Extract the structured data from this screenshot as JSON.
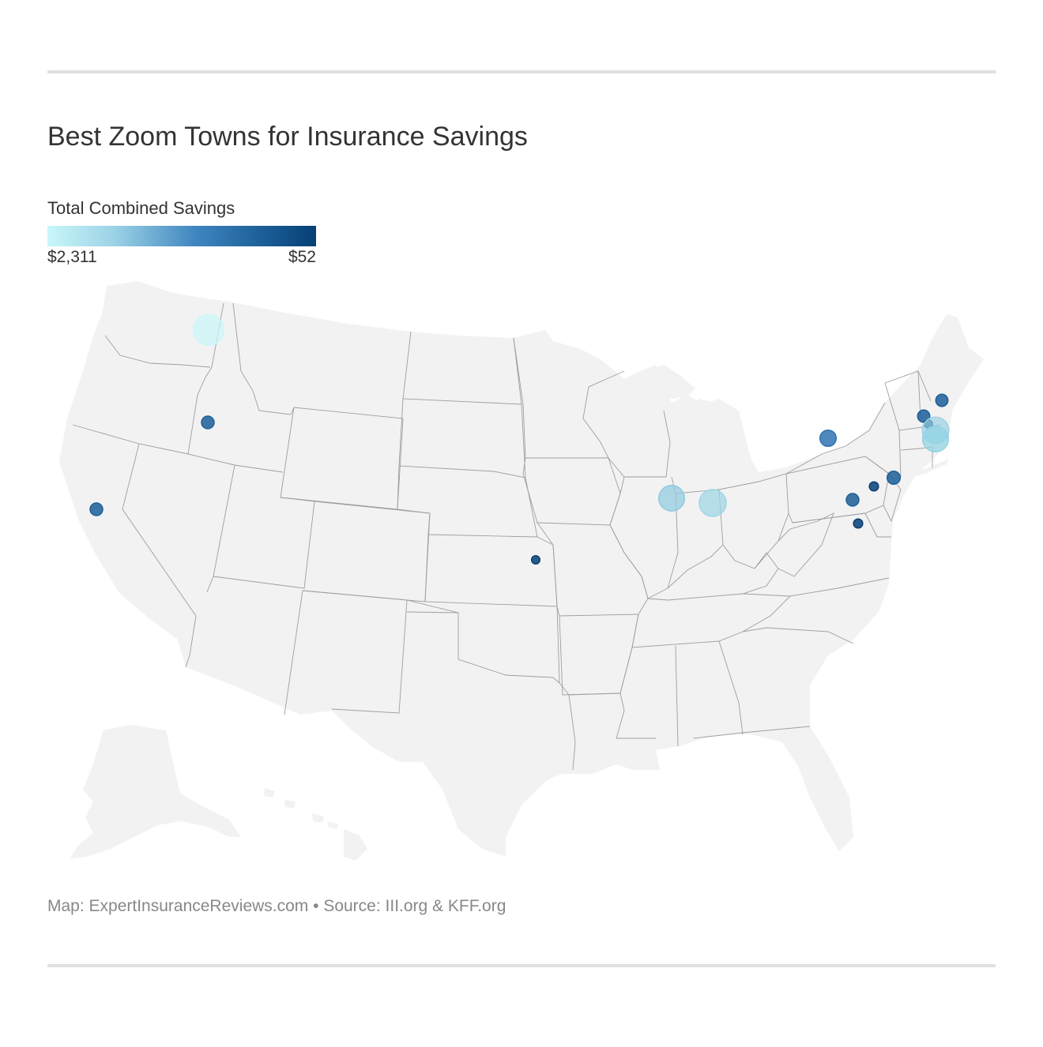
{
  "title": "Best Zoom Towns for Insurance Savings",
  "legend": {
    "title": "Total Combined Savings",
    "min_label": "$2,311",
    "max_label": "$52",
    "colors": [
      "#c9f7fa",
      "#9bd2e6",
      "#3f86c0",
      "#1c5f98",
      "#063f75"
    ]
  },
  "footer": {
    "credit": "Map: ExpertInsuranceReviews.com • Source: III.org & KFF.org"
  },
  "map": {
    "background": "#f2f2f2",
    "border": "#9e9e9e",
    "projection": "albers-usa"
  },
  "markers": [
    {
      "id": "wa-spokane",
      "color": "#c9f7fa",
      "level": 0.05
    },
    {
      "id": "id-boise",
      "color": "#1c5f98",
      "level": 0.8
    },
    {
      "id": "ca-tahoe",
      "color": "#1c5f98",
      "level": 0.8
    },
    {
      "id": "ks-wichita",
      "color": "#063f75",
      "level": 0.98
    },
    {
      "id": "il-chicago",
      "color": "#8fcbe0",
      "level": 0.25
    },
    {
      "id": "in-indianapolis",
      "color": "#9dd6e6",
      "level": 0.2
    },
    {
      "id": "ny-rochester",
      "color": "#2f73b2",
      "level": 0.65
    },
    {
      "id": "pa-harrisburg",
      "color": "#1c5f98",
      "level": 0.8
    },
    {
      "id": "pa-philadelphia",
      "color": "#063f75",
      "level": 0.95
    },
    {
      "id": "nj-newark",
      "color": "#1c5f98",
      "level": 0.78
    },
    {
      "id": "md-baltimore",
      "color": "#063f75",
      "level": 0.95
    },
    {
      "id": "vt-burlington",
      "color": "#1c5f98",
      "level": 0.82
    },
    {
      "id": "ma-westfield",
      "color": "#063f75",
      "level": 0.98
    },
    {
      "id": "nh-portsmouth",
      "color": "#1c5f98",
      "level": 0.82
    },
    {
      "id": "ma-boston",
      "color": "#9bd2e6",
      "level": 0.22
    },
    {
      "id": "ri-providence",
      "color": "#8fd3e3",
      "level": 0.25
    }
  ]
}
